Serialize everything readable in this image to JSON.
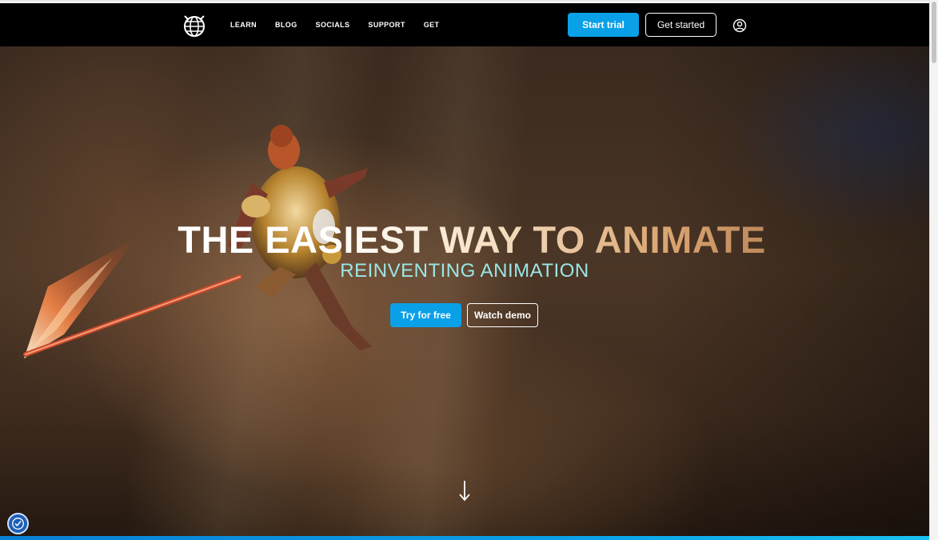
{
  "nav": {
    "logo_icon": "globe-cat-logo-icon",
    "links": [
      "LEARN",
      "BLOG",
      "SOCIALS",
      "SUPPORT",
      "GET"
    ],
    "start_trial": "Start trial",
    "get_started": "Get started",
    "user_icon": "user-circle-icon"
  },
  "hero": {
    "headline": "THE EASIEST WAY TO ANIMATE",
    "subheadline": "REINVENTING ANIMATION",
    "try_free": "Try for free",
    "watch_demo": "Watch demo",
    "scroll_icon": "arrow-down-icon"
  },
  "accessibility": {
    "icon": "accessibility-icon"
  },
  "colors": {
    "accent": "#0aa0e8",
    "nav_bg": "#000000",
    "subheadline": "#9be6e6"
  }
}
